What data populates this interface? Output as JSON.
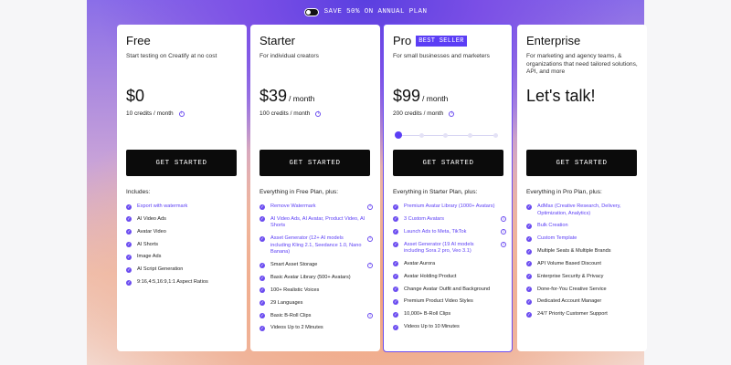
{
  "promo": {
    "label": "SAVE 50% ON ANNUAL PLAN"
  },
  "colors": {
    "accent": "#5b3ef5",
    "button": "#0b0b0b"
  },
  "plans": [
    {
      "name": "Free",
      "description": "Start testing on Creatify at no cost",
      "price": "$0",
      "per": "",
      "credits": "10 credits / month",
      "cta": "GET STARTED",
      "includes": "Includes:",
      "features": [
        "Export with watermark",
        "AI Video Ads",
        "Avatar Video",
        "AI Shorts",
        "Image Ads",
        "AI Script Generation",
        "9:16,4:5,16:9,1:1 Aspect Ratios"
      ]
    },
    {
      "name": "Starter",
      "description": "For individual creators",
      "price": "$39",
      "per": "/ month",
      "credits": "100 credits / month",
      "cta": "GET STARTED",
      "includes": "Everything in Free Plan, plus:",
      "features": [
        "Remove Watermark",
        "AI Video Ads, AI Avatar, Product Video, AI Shorts",
        "Asset Generator (12+ AI models including Kling 2.1, Seedance 1.0, Nano Banana)",
        "Smart Asset Storage",
        "Basic Avatar Library (500+ Avatars)",
        "100+ Realistic Voices",
        "29 Languages",
        "Basic B-Roll Clips",
        "Videos Up to 2 Minutes"
      ]
    },
    {
      "name": "Pro",
      "badge": "BEST SELLER",
      "description": "For small businesses and marketers",
      "price": "$99",
      "per": "/ month",
      "credits": "200 credits / month",
      "slider_level": 0,
      "cta": "GET STARTED",
      "includes": "Everything in Starter Plan, plus:",
      "features": [
        "Premium Avatar Library (1000+ Avatars)",
        "3 Custom Avatars",
        "Launch Ads to Meta, TikTok",
        "Asset Generator (19 AI models including Sora 2 pro, Veo 3.1)",
        "Avatar Aurora",
        "Avatar Holding Product",
        "Change Avatar Outfit and Background",
        "Premium Product Video Styles",
        "10,000+ B-Roll Clips",
        "Videos Up to 10 Minutes"
      ]
    },
    {
      "name": "Enterprise",
      "description": "For marketing and agency teams, & organizations that need tailored solutions, API, and more",
      "price": "Let's talk!",
      "cta": "GET STARTED",
      "includes": "Everything in Pro Plan, plus:",
      "features": [
        "AdMax (Creative Research, Delivery, Optimization, Analytics)",
        "Bulk Creation",
        "Custom Template",
        "Multiple Seats & Multiple Brands",
        "API Volume Based Discount",
        "Enterprise Security & Privacy",
        "Done-for-You Creative Service",
        "Dedicated Account Manager",
        "24/7 Priority Customer Support"
      ]
    }
  ]
}
